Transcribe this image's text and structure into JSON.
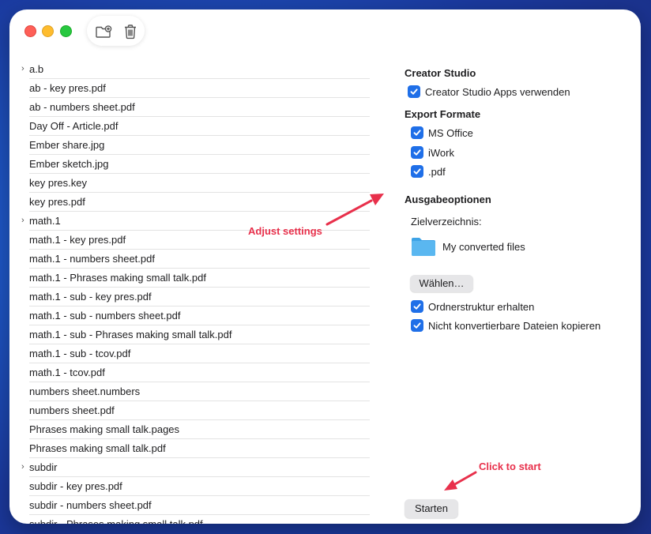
{
  "toolbar": {
    "new_folder_icon": "folder-plus-icon",
    "trash_icon": "trash-icon"
  },
  "files": [
    {
      "name": "a.b",
      "folder": true
    },
    {
      "name": "ab - key pres.pdf",
      "folder": false
    },
    {
      "name": "ab - numbers sheet.pdf",
      "folder": false
    },
    {
      "name": "Day Off - Article.pdf",
      "folder": false
    },
    {
      "name": "Ember share.jpg",
      "folder": false
    },
    {
      "name": "Ember sketch.jpg",
      "folder": false
    },
    {
      "name": "key pres.key",
      "folder": false
    },
    {
      "name": "key pres.pdf",
      "folder": false
    },
    {
      "name": "math.1",
      "folder": true
    },
    {
      "name": "math.1 - key pres.pdf",
      "folder": false
    },
    {
      "name": "math.1 - numbers sheet.pdf",
      "folder": false
    },
    {
      "name": "math.1 - Phrases making small talk.pdf",
      "folder": false
    },
    {
      "name": "math.1 - sub - key pres.pdf",
      "folder": false
    },
    {
      "name": "math.1 - sub - numbers sheet.pdf",
      "folder": false
    },
    {
      "name": "math.1 - sub - Phrases making small talk.pdf",
      "folder": false
    },
    {
      "name": "math.1 - sub - tcov.pdf",
      "folder": false
    },
    {
      "name": "math.1 - tcov.pdf",
      "folder": false
    },
    {
      "name": "numbers sheet.numbers",
      "folder": false
    },
    {
      "name": "numbers sheet.pdf",
      "folder": false
    },
    {
      "name": "Phrases making small talk.pages",
      "folder": false
    },
    {
      "name": "Phrases making small talk.pdf",
      "folder": false
    },
    {
      "name": "subdir",
      "folder": true
    },
    {
      "name": "subdir - key pres.pdf",
      "folder": false
    },
    {
      "name": "subdir - numbers sheet.pdf",
      "folder": false
    },
    {
      "name": "subdir - Phrases making small talk.pdf",
      "folder": false
    }
  ],
  "settings": {
    "creator_studio": {
      "title": "Creator Studio",
      "use_apps_label": "Creator Studio Apps verwenden",
      "use_apps_checked": true
    },
    "export_formats": {
      "title": "Export Formate",
      "options": [
        {
          "label": "MS Office",
          "checked": true
        },
        {
          "label": "iWork",
          "checked": true
        },
        {
          "label": ".pdf",
          "checked": true
        }
      ]
    },
    "output": {
      "title": "Ausgabeoptionen",
      "target_dir_label": "Zielverzeichnis:",
      "folder_name": "My converted files",
      "choose_button": "Wählen…",
      "keep_structure_label": "Ordnerstruktur erhalten",
      "keep_structure_checked": true,
      "copy_unconvertible_label": "Nicht konvertierbare Dateien kopieren",
      "copy_unconvertible_checked": true
    },
    "start_button": "Starten"
  },
  "annotations": {
    "adjust": "Adjust settings",
    "start": "Click to start",
    "color": "#e8304b"
  },
  "colors": {
    "accent": "#1f6fe8",
    "folder": "#5ab7f0"
  }
}
